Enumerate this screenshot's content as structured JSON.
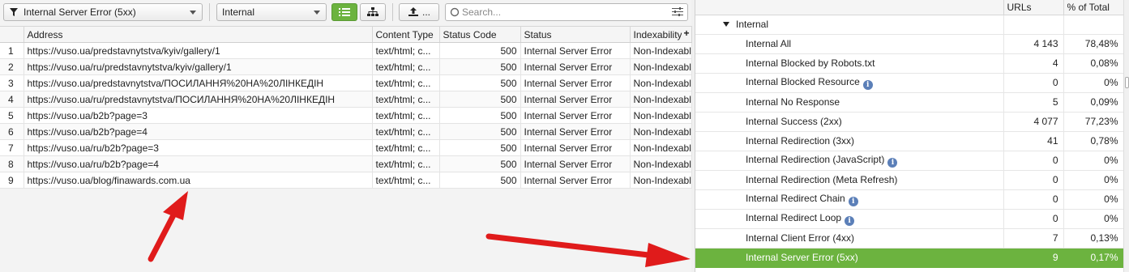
{
  "toolbar": {
    "filter_value": "Internal Server Error (5xx)",
    "type_value": "Internal",
    "export_label": "...",
    "search_placeholder": "Search..."
  },
  "grid": {
    "columns": [
      "Address",
      "Content Type",
      "Status Code",
      "Status",
      "Indexability"
    ],
    "add_column_label": "+",
    "rows": [
      {
        "n": "1",
        "address": "https://vuso.ua/predstavnytstva/kyiv/gallery/1",
        "content_type": "text/html; c...",
        "status_code": "500",
        "status": "Internal Server Error",
        "indexability": "Non-Indexable"
      },
      {
        "n": "2",
        "address": "https://vuso.ua/ru/predstavnytstva/kyiv/gallery/1",
        "content_type": "text/html; c...",
        "status_code": "500",
        "status": "Internal Server Error",
        "indexability": "Non-Indexable"
      },
      {
        "n": "3",
        "address": "https://vuso.ua/predstavnytstva/ПОСИЛАННЯ%20НА%20ЛІНКЕДІН",
        "content_type": "text/html; c...",
        "status_code": "500",
        "status": "Internal Server Error",
        "indexability": "Non-Indexable"
      },
      {
        "n": "4",
        "address": "https://vuso.ua/ru/predstavnytstva/ПОСИЛАННЯ%20НА%20ЛІНКЕДІН",
        "content_type": "text/html; c...",
        "status_code": "500",
        "status": "Internal Server Error",
        "indexability": "Non-Indexable"
      },
      {
        "n": "5",
        "address": "https://vuso.ua/b2b?page=3",
        "content_type": "text/html; c...",
        "status_code": "500",
        "status": "Internal Server Error",
        "indexability": "Non-Indexable"
      },
      {
        "n": "6",
        "address": "https://vuso.ua/b2b?page=4",
        "content_type": "text/html; c...",
        "status_code": "500",
        "status": "Internal Server Error",
        "indexability": "Non-Indexable"
      },
      {
        "n": "7",
        "address": "https://vuso.ua/ru/b2b?page=3",
        "content_type": "text/html; c...",
        "status_code": "500",
        "status": "Internal Server Error",
        "indexability": "Non-Indexable"
      },
      {
        "n": "8",
        "address": "https://vuso.ua/ru/b2b?page=4",
        "content_type": "text/html; c...",
        "status_code": "500",
        "status": "Internal Server Error",
        "indexability": "Non-Indexable"
      },
      {
        "n": "9",
        "address": "https://vuso.ua/blog/finawards.com.ua",
        "content_type": "text/html; c...",
        "status_code": "500",
        "status": "Internal Server Error",
        "indexability": "Non-Indexable"
      }
    ]
  },
  "overview": {
    "columns": {
      "urls": "URLs",
      "pct": "% of Total"
    },
    "group_label": "Internal",
    "rows": [
      {
        "label": "Internal All",
        "urls": "4 143",
        "pct": "78,48%",
        "info": false,
        "selected": false
      },
      {
        "label": "Internal Blocked by Robots.txt",
        "urls": "4",
        "pct": "0,08%",
        "info": false,
        "selected": false
      },
      {
        "label": "Internal Blocked Resource",
        "urls": "0",
        "pct": "0%",
        "info": true,
        "selected": false
      },
      {
        "label": "Internal No Response",
        "urls": "5",
        "pct": "0,09%",
        "info": false,
        "selected": false
      },
      {
        "label": "Internal Success (2xx)",
        "urls": "4 077",
        "pct": "77,23%",
        "info": false,
        "selected": false
      },
      {
        "label": "Internal Redirection (3xx)",
        "urls": "41",
        "pct": "0,78%",
        "info": false,
        "selected": false
      },
      {
        "label": "Internal Redirection (JavaScript)",
        "urls": "0",
        "pct": "0%",
        "info": true,
        "selected": false
      },
      {
        "label": "Internal Redirection (Meta Refresh)",
        "urls": "0",
        "pct": "0%",
        "info": false,
        "selected": false
      },
      {
        "label": "Internal Redirect Chain",
        "urls": "0",
        "pct": "0%",
        "info": true,
        "selected": false
      },
      {
        "label": "Internal Redirect Loop",
        "urls": "0",
        "pct": "0%",
        "info": true,
        "selected": false
      },
      {
        "label": "Internal Client Error (4xx)",
        "urls": "7",
        "pct": "0,13%",
        "info": false,
        "selected": false
      },
      {
        "label": "Internal Server Error (5xx)",
        "urls": "9",
        "pct": "0,17%",
        "info": false,
        "selected": true
      }
    ]
  },
  "colors": {
    "accent_green": "#6cb33f",
    "arrow_red": "#e01b1b",
    "info_blue": "#5b7fb8"
  },
  "icons": {
    "filter": "funnel-icon",
    "list_view": "list-view-icon",
    "tree_view": "tree-view-icon",
    "export": "export-icon",
    "search": "search-icon",
    "search_options": "sliders-icon",
    "info": "info-icon"
  }
}
